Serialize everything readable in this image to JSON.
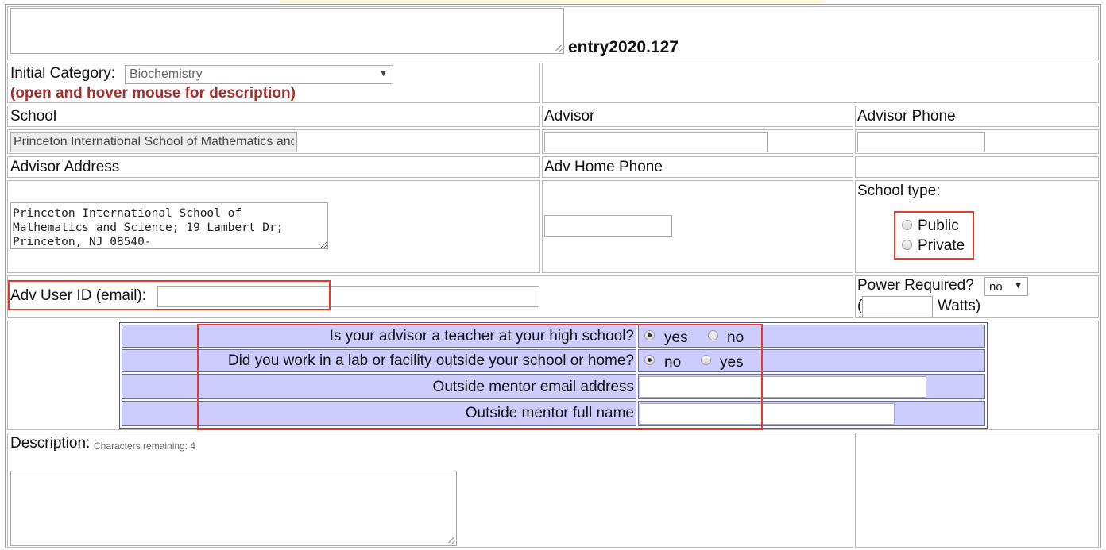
{
  "entry": {
    "id_label": "entry2020.127"
  },
  "category": {
    "label": "Initial Category:",
    "selected": "Biochemistry",
    "hint": "(open and hover mouse for description)"
  },
  "headers": {
    "school": "School",
    "advisor": "Advisor",
    "advisor_phone": "Advisor Phone",
    "advisor_address": "Advisor Address",
    "adv_home_phone": "Adv Home Phone"
  },
  "school": {
    "value": "Princeton International School of Mathematics and Science"
  },
  "address": {
    "value": "Princeton International School of\nMathematics and Science; 19 Lambert Dr;\nPrinceton, NJ 08540-"
  },
  "school_type": {
    "label": "School type:",
    "options": [
      "Public",
      "Private"
    ],
    "selected": null
  },
  "adv_user": {
    "label": "Adv User ID (email):",
    "value": ""
  },
  "power": {
    "label": "Power Required?",
    "selected": "no",
    "open_paren": "(",
    "watts_label": "Watts)"
  },
  "questions": [
    {
      "text": "Is your advisor a teacher at your high school?",
      "options": [
        "yes",
        "no"
      ],
      "selected": "yes"
    },
    {
      "text": "Did you work in a lab or facility outside your school or home?",
      "options": [
        "no",
        "yes"
      ],
      "selected": "no"
    },
    {
      "text": "Outside mentor email address",
      "value": ""
    },
    {
      "text": "Outside mentor full name",
      "value": ""
    }
  ],
  "description": {
    "label": "Description:",
    "remaining": "Characters remaining: 4"
  },
  "colors": {
    "highlight": "#e53b2a",
    "panel": "#ccccff",
    "hint": "#a0302f"
  }
}
